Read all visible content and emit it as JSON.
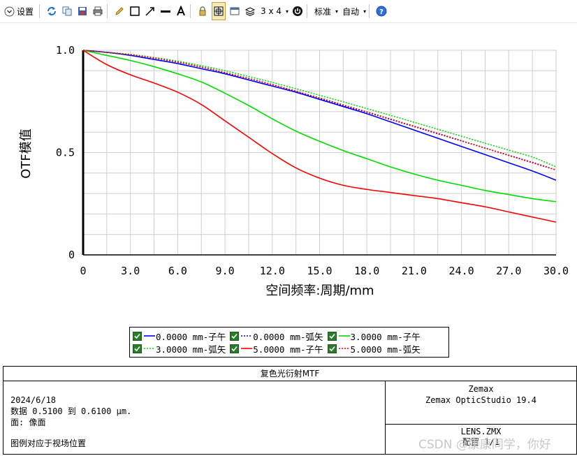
{
  "toolbar": {
    "settings_label": "设置",
    "layout_label": "3 x 4",
    "standard_label": "标准",
    "auto_label": "自动"
  },
  "chart_data": {
    "type": "line",
    "title": "",
    "xlabel": "空间频率:周期/mm",
    "ylabel": "OTF模值",
    "xlim": [
      0,
      30
    ],
    "ylim": [
      0,
      1
    ],
    "x_ticks": [
      "0",
      "3.0",
      "6.0",
      "9.0",
      "12.0",
      "15.0",
      "18.0",
      "21.0",
      "24.0",
      "27.0",
      "30.0"
    ],
    "y_ticks": [
      "0",
      "0.5",
      "1.0"
    ],
    "grid": true,
    "legend_position": "bottom",
    "x": [
      0,
      1.5,
      3,
      4.5,
      6,
      7.5,
      9,
      10.5,
      12,
      13.5,
      15,
      16.5,
      18,
      19.5,
      21,
      22.5,
      24,
      25.5,
      27,
      28.5,
      30
    ],
    "series": [
      {
        "name": "0.0000 mm-子午",
        "color": "#0000ff",
        "dash": "solid",
        "values": [
          1.0,
          0.99,
          0.975,
          0.955,
          0.935,
          0.91,
          0.885,
          0.855,
          0.825,
          0.795,
          0.76,
          0.725,
          0.69,
          0.65,
          0.61,
          0.57,
          0.53,
          0.49,
          0.45,
          0.41,
          0.365
        ]
      },
      {
        "name": "0.0000 mm-弧矢",
        "color": "#0000ff",
        "dash": "dotted",
        "values": [
          1.0,
          0.99,
          0.978,
          0.962,
          0.942,
          0.918,
          0.89,
          0.862,
          0.832,
          0.8,
          0.765,
          0.73,
          0.697,
          0.662,
          0.627,
          0.592,
          0.557,
          0.522,
          0.487,
          0.452,
          0.415
        ]
      },
      {
        "name": "3.0000 mm-子午",
        "color": "#00dd00",
        "dash": "solid",
        "values": [
          1.0,
          0.975,
          0.95,
          0.92,
          0.885,
          0.845,
          0.79,
          0.73,
          0.665,
          0.605,
          0.555,
          0.51,
          0.47,
          0.43,
          0.395,
          0.365,
          0.34,
          0.315,
          0.295,
          0.275,
          0.26
        ]
      },
      {
        "name": "3.0000 mm-弧矢",
        "color": "#00dd00",
        "dash": "dotted",
        "values": [
          1.0,
          0.99,
          0.98,
          0.965,
          0.947,
          0.925,
          0.9,
          0.872,
          0.843,
          0.812,
          0.78,
          0.748,
          0.715,
          0.682,
          0.648,
          0.614,
          0.58,
          0.546,
          0.512,
          0.478,
          0.43
        ]
      },
      {
        "name": "5.0000 mm-子午",
        "color": "#ff0000",
        "dash": "solid",
        "values": [
          1.0,
          0.93,
          0.88,
          0.84,
          0.795,
          0.735,
          0.655,
          0.575,
          0.495,
          0.425,
          0.375,
          0.34,
          0.32,
          0.305,
          0.29,
          0.275,
          0.255,
          0.235,
          0.21,
          0.185,
          0.16
        ]
      },
      {
        "name": "5.0000 mm-弧矢",
        "color": "#ff0000",
        "dash": "dotted",
        "values": [
          1.0,
          0.99,
          0.978,
          0.962,
          0.942,
          0.918,
          0.891,
          0.862,
          0.832,
          0.8,
          0.767,
          0.733,
          0.699,
          0.664,
          0.629,
          0.594,
          0.558,
          0.522,
          0.486,
          0.45,
          0.415
        ]
      }
    ]
  },
  "legend": {
    "items": [
      {
        "label": "0.0000 mm-子午"
      },
      {
        "label": "0.0000 mm-弧矢"
      },
      {
        "label": "3.0000 mm-子午"
      },
      {
        "label": "3.0000 mm-弧矢"
      },
      {
        "label": "5.0000 mm-子午"
      },
      {
        "label": "5.0000 mm-弧矢"
      }
    ]
  },
  "info": {
    "title": "复色光衍射MTF",
    "date": "2024/6/18",
    "data_line": "数据 0.5100 到 0.6100 μm.",
    "surface_line": "面: 像面",
    "note": "图例对应于视场位置",
    "company": "Zemax",
    "product": "Zemax OpticStudio 19.4",
    "lens_file": "LENS.ZMX",
    "config": "配置 1/1"
  },
  "watermark": "CSDN @康康同学，你好"
}
